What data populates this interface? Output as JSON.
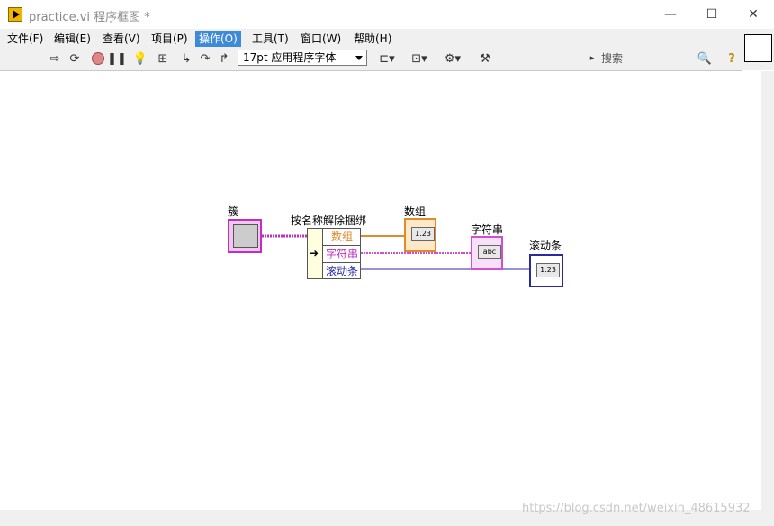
{
  "window": {
    "title": "practice.vi 程序框图 *"
  },
  "menu": [
    {
      "label": "文件(F)"
    },
    {
      "label": "编辑(E)"
    },
    {
      "label": "查看(V)"
    },
    {
      "label": "项目(P)"
    },
    {
      "label": "操作(O)",
      "active": true
    },
    {
      "label": "工具(T)"
    },
    {
      "label": "窗口(W)"
    },
    {
      "label": "帮助(H)"
    }
  ],
  "toolbar": {
    "font_select": "17pt 应用程序字体",
    "search_placeholder": "搜索"
  },
  "diagram": {
    "cluster_label": "簇",
    "unbundle_label": "按名称解除捆绑",
    "unbundle_rows": [
      "数组",
      "字符串",
      "滚动条"
    ],
    "array_label": "数组",
    "string_label": "字符串",
    "slider_label": "滚动条",
    "array_inner": "1.23",
    "string_inner": "abc",
    "slider_inner": "1.23"
  },
  "watermark": "https://blog.csdn.net/weixin_48615932",
  "colors": {
    "accent": "#3c8ad8",
    "cluster_wire": "#c030c0",
    "array_wire": "#e08a2a",
    "slider_wire": "#2a2aa0"
  }
}
